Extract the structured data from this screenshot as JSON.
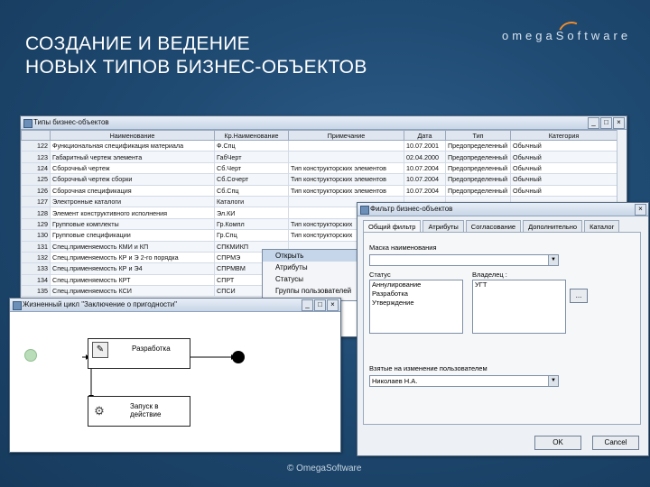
{
  "slide": {
    "title_line1": "СОЗДАНИЕ И ВЕДЕНИЕ",
    "title_line2": "НОВЫХ ТИПОВ БИЗНЕС-ОБЪЕКТОВ",
    "logo": "omegaSoftware",
    "footer": "© OmegaSoftware"
  },
  "types_window": {
    "title": "Типы бизнес-объектов",
    "columns": [
      "",
      "Наименование",
      "Кр.Наименование",
      "Примечание",
      "Дата",
      "Тип",
      "Категория"
    ],
    "rows": [
      [
        "122",
        "Функциональная спецификация материала",
        "Ф.Спц",
        "",
        "10.07.2001",
        "Предопределенный",
        "Обычный"
      ],
      [
        "123",
        "Габаритный чертеж элемента",
        "ГабЧерт",
        "",
        "02.04.2000",
        "Предопределенный",
        "Обычный"
      ],
      [
        "124",
        "Сборочный чертеж",
        "Сб.Черт",
        "Тип конструкторских элементов",
        "10.07.2004",
        "Предопределенный",
        "Обычный"
      ],
      [
        "125",
        "Сборочный чертеж сборки",
        "Сб.Сочерт",
        "Тип конструкторских элементов",
        "10.07.2004",
        "Предопределенный",
        "Обычный"
      ],
      [
        "126",
        "Сборочная спецификация",
        "Сб.Спц",
        "Тип конструкторских элементов",
        "10.07.2004",
        "Предопределенный",
        "Обычный"
      ],
      [
        "127",
        "Электронные каталоги",
        "Каталоги",
        "",
        "",
        "",
        ""
      ],
      [
        "128",
        "Элемент конструктивного исполнения",
        "Эл.КИ",
        "",
        "",
        "",
        ""
      ],
      [
        "129",
        "Групповые комплекты",
        "Гр.Компл",
        "Тип конструкторских",
        "",
        "",
        ""
      ],
      [
        "130",
        "Групповые спецификации",
        "Гр.Спц",
        "Тип конструкторских",
        "",
        "",
        ""
      ],
      [
        "131",
        "Спец.применяемость КМИ и КП",
        "СПКМИКП",
        "",
        "",
        "",
        ""
      ],
      [
        "132",
        "Спец.применяемость КР и Э 2-го порядка",
        "СПРМЭ",
        "",
        "",
        "",
        ""
      ],
      [
        "133",
        "Спец.применяемость КР и Э4",
        "СПРМВМ",
        "",
        "",
        "",
        ""
      ],
      [
        "134",
        "Спец.применяемость КРТ",
        "СПРТ",
        "",
        "",
        "",
        ""
      ],
      [
        "135",
        "Спец.применяемость КСИ",
        "СПСИ",
        "",
        "",
        "",
        ""
      ]
    ],
    "context_menu": [
      "Открыть",
      "Атрибуты",
      "Статусы",
      "Группы пользователей"
    ]
  },
  "lifecycle_window": {
    "title": "Жизненный цикл \"Заключение о пригодности\"",
    "node1": "Разработка",
    "node2": "Запуск в действие"
  },
  "filter_dialog": {
    "title": "Фильтр бизнес-объектов",
    "tabs": [
      "Общий фильтр",
      "Атрибуты",
      "Согласование",
      "Дополнительно",
      "Каталог"
    ],
    "mask_label": "Маска наименования",
    "mask_value": "",
    "status_label": "Статус",
    "statuses": [
      "Аннулирование",
      "Разработка",
      "Утверждение"
    ],
    "owner_label": "Владелец :",
    "owner_value": "УГТ",
    "browse": "...",
    "modified_label": "Взятые на изменение пользователем",
    "modified_value": "Николаев Н.А.",
    "ok": "OK",
    "cancel": "Cancel"
  }
}
